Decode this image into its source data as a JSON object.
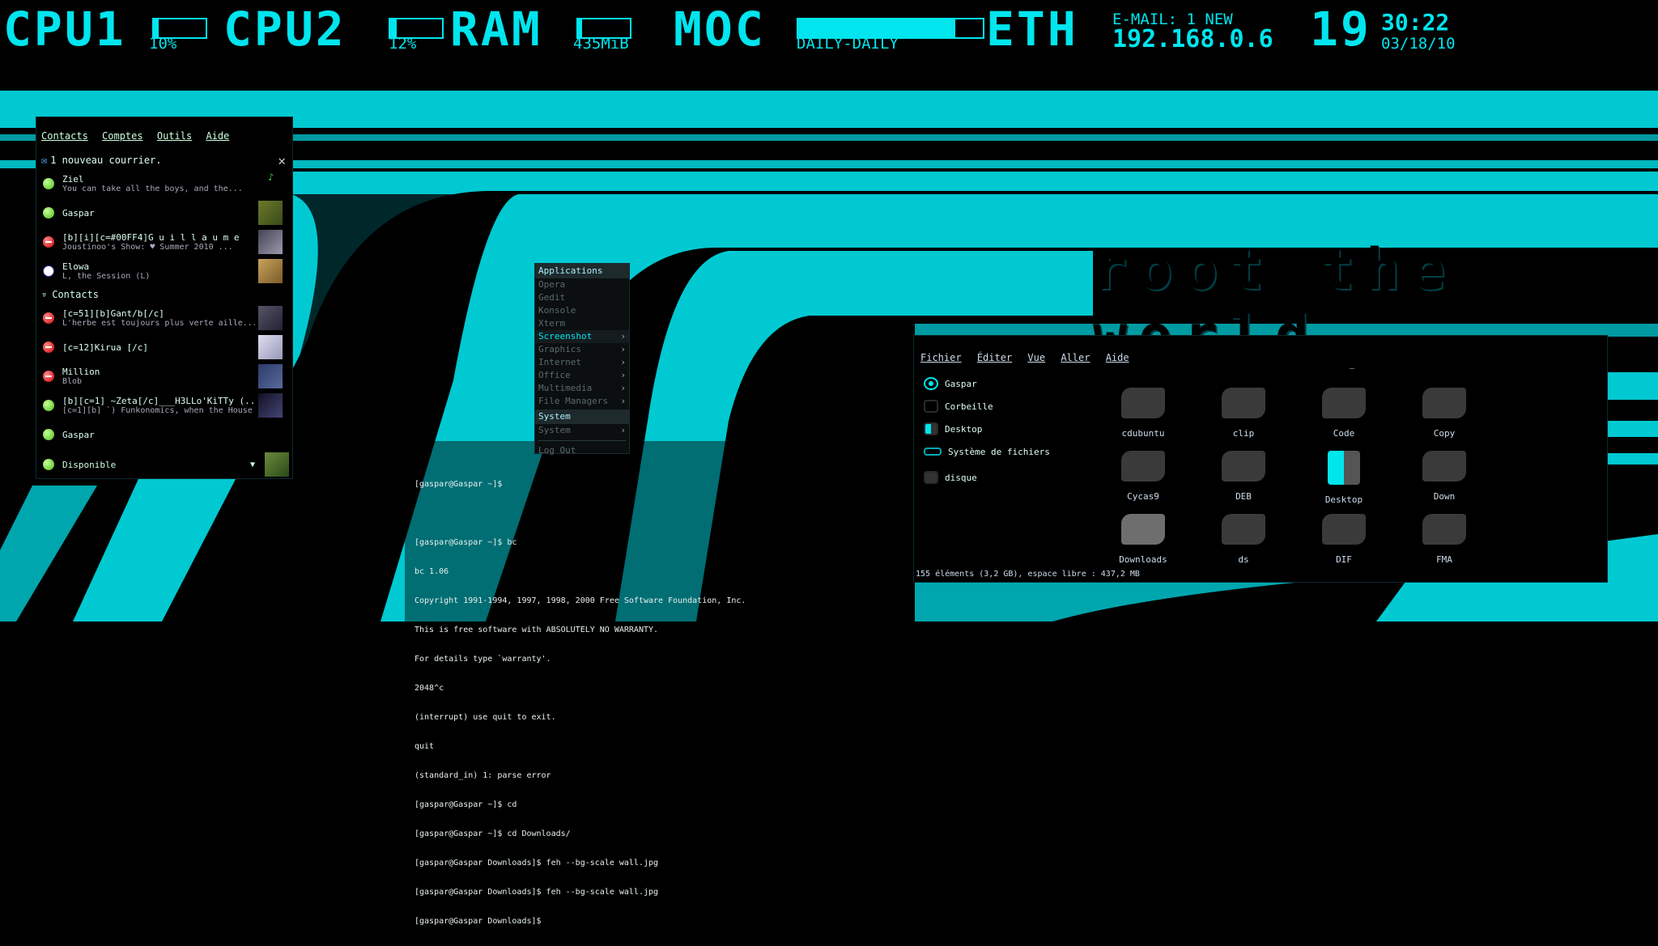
{
  "topbar": {
    "cpu1_label": "CPU1",
    "cpu1_value": "10%",
    "cpu1_percent": 10,
    "cpu2_label": "CPU2",
    "cpu2_value": "12%",
    "cpu2_percent": 12,
    "ram_label": "RAM",
    "ram_value": "435MiB",
    "moc_label": "MOC",
    "moc_track": "DAILY-DAILY",
    "eth_label": "ETH",
    "email_text": "E-MAIL: 1 NEW",
    "ip_address": "192.168.0.6",
    "clock_hour": "19",
    "clock_minutes": "30:22",
    "clock_date": "03/18/10"
  },
  "wallpaper": {
    "text": "root the world",
    "accent_color": "#00e5ee"
  },
  "contacts_window": {
    "menu": [
      "Contacts",
      "Comptes",
      "Outils",
      "Aide"
    ],
    "notification": "1 nouveau courrier.",
    "close_icon": "close-icon",
    "items": [
      {
        "name": "Ziel",
        "message": "You can take all the boys, and the...",
        "status": "online"
      },
      {
        "name": "Gaspar",
        "message": "",
        "status": "online"
      },
      {
        "name": "[b][i][c=#00FF4]G u i l l a u m e",
        "message": "Joustinoo's Show: ♥  Summer 2010 ...",
        "status": "busy"
      },
      {
        "name": "Elowa",
        "message": "L, the Session (L)",
        "status": "away"
      }
    ],
    "group_label": "Contacts",
    "group_items": [
      {
        "name": "[c=51][b]Gant/b[/c]",
        "message": "L'herbe est toujours plus verte aille...",
        "status": "busy"
      },
      {
        "name": "[c=12]Kirua [/c]",
        "message": "",
        "status": "busy"
      },
      {
        "name": "Million",
        "message": "Blob",
        "status": "busy"
      },
      {
        "name": "[b][c=1]  ~Zeta[/c]___H3LLo'KiTTy (...",
        "message": "[c=1][b] `) Funkonomics, when the House ...",
        "status": "online"
      },
      {
        "name": "Gaspar",
        "message": "",
        "status": "online"
      }
    ],
    "footer_status": "Disponible"
  },
  "app_menu": {
    "header": "Applications",
    "items": [
      {
        "label": "Opera",
        "submenu": false,
        "state": "normal"
      },
      {
        "label": "Gedit",
        "submenu": false,
        "state": "normal"
      },
      {
        "label": "Konsole",
        "submenu": false,
        "state": "normal"
      },
      {
        "label": "Xterm",
        "submenu": false,
        "state": "normal"
      },
      {
        "label": "Screenshot",
        "submenu": true,
        "state": "selected"
      },
      {
        "label": "Graphics",
        "submenu": true,
        "state": "normal"
      },
      {
        "label": "Internet",
        "submenu": true,
        "state": "normal"
      },
      {
        "label": "Office",
        "submenu": true,
        "state": "normal"
      },
      {
        "label": "Multimedia",
        "submenu": true,
        "state": "normal"
      },
      {
        "label": "File Managers",
        "submenu": true,
        "state": "normal"
      }
    ],
    "system_header": "System",
    "system_item": "System",
    "logout": "Log Out"
  },
  "terminal": {
    "lines": [
      "[gaspar@Gaspar ~]$",
      "",
      "[gaspar@Gaspar ~]$ bc",
      "bc 1.06",
      "Copyright 1991-1994, 1997, 1998, 2000 Free Software Foundation, Inc.",
      "This is free software with ABSOLUTELY NO WARRANTY.",
      "For details type `warranty'.",
      "2048^c",
      "(interrupt) use quit to exit.",
      "quit",
      "(standard_in) 1: parse error",
      "[gaspar@Gaspar ~]$ cd",
      "[gaspar@Gaspar ~]$ cd Downloads/",
      "[gaspar@Gaspar Downloads]$ feh --bg-scale wall.jpg",
      "[gaspar@Gaspar Downloads]$ feh --bg-scale wall.jpg",
      "[gaspar@Gaspar Downloads]$"
    ]
  },
  "file_manager": {
    "menu": [
      "Fichier",
      "Éditer",
      "Vue",
      "Aller",
      "Aide"
    ],
    "places": [
      "Gaspar",
      "Corbeille",
      "Desktop",
      "Système de fichiers",
      "disque"
    ],
    "items": [
      {
        "name": "cdubuntu"
      },
      {
        "name": "clip"
      },
      {
        "name": "Code"
      },
      {
        "name": "Copy"
      },
      {
        "name": "Cycas9"
      },
      {
        "name": "DEB"
      },
      {
        "name": "Desktop"
      },
      {
        "name": "Down"
      },
      {
        "name": "Downloads"
      },
      {
        "name": "ds"
      },
      {
        "name": "DIF"
      },
      {
        "name": "FMA"
      }
    ],
    "status": "155 éléments (3,2 GB), espace libre : 437,2 MB"
  }
}
